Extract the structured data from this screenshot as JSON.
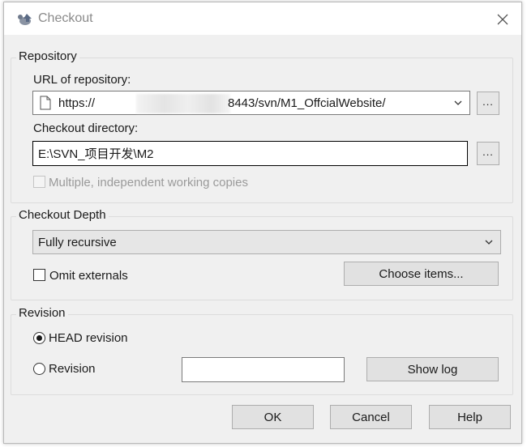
{
  "window": {
    "title": "Checkout",
    "close_glyph": "✕"
  },
  "repository": {
    "group_label": "Repository",
    "url_label": "URL of repository:",
    "url_prefix": "https://",
    "url_suffix": "8443/svn/M1_OffcialWebsite/",
    "browse_label": "...",
    "dir_label": "Checkout directory:",
    "dir_value": "E:\\SVN_项目开发\\M2",
    "dir_browse_label": "...",
    "multiple_label": "Multiple, independent working copies",
    "multiple_checked": false
  },
  "depth": {
    "group_label": "Checkout Depth",
    "selected": "Fully recursive",
    "omit_label": "Omit externals",
    "omit_checked": false,
    "choose_items_label": "Choose items..."
  },
  "revision": {
    "group_label": "Revision",
    "head_label": "HEAD revision",
    "head_selected": true,
    "revision_label": "Revision",
    "revision_value": "",
    "show_log_label": "Show log"
  },
  "footer": {
    "ok_label": "OK",
    "cancel_label": "Cancel",
    "help_label": "Help"
  },
  "icons": {
    "title": "tortoise-svn-icon",
    "file": "file-icon",
    "dropdown": "chevron-down-icon",
    "close": "close-icon"
  }
}
